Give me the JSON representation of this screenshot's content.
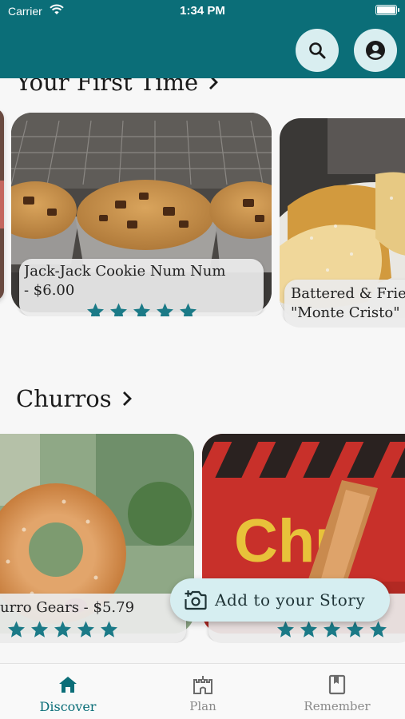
{
  "status_bar": {
    "carrier": "Carrier",
    "time": "1:34 PM"
  },
  "header": {
    "search_icon": "search-icon",
    "account_icon": "account-circle-icon"
  },
  "sections": [
    {
      "title": "Your First Time",
      "cards": [
        {
          "name_line1": "Jack-Jack Cookie Num Num",
          "name_line2": "- $6.00",
          "rating": 5
        },
        {
          "name_line1": "Battered & Frie",
          "name_line2": "\"Monte Cristo\"",
          "rating": 0
        }
      ]
    },
    {
      "title": "Churros",
      "cards": [
        {
          "name_line1": "urro Gears - $5.79",
          "rating": 5
        },
        {
          "name_line1": "",
          "rating": 5
        }
      ]
    }
  ],
  "fab": {
    "label": "Add to your Story",
    "icon": "add-photo-icon"
  },
  "bottom_nav": {
    "items": [
      {
        "label": "Discover",
        "icon": "home-icon",
        "active": true
      },
      {
        "label": "Plan",
        "icon": "castle-icon",
        "active": false
      },
      {
        "label": "Remember",
        "icon": "book-icon",
        "active": false
      }
    ]
  },
  "colors": {
    "primary": "#0b6e78",
    "star": "#1b7a87",
    "fab_bg": "#d6eef1",
    "background": "#f7f7f7"
  }
}
